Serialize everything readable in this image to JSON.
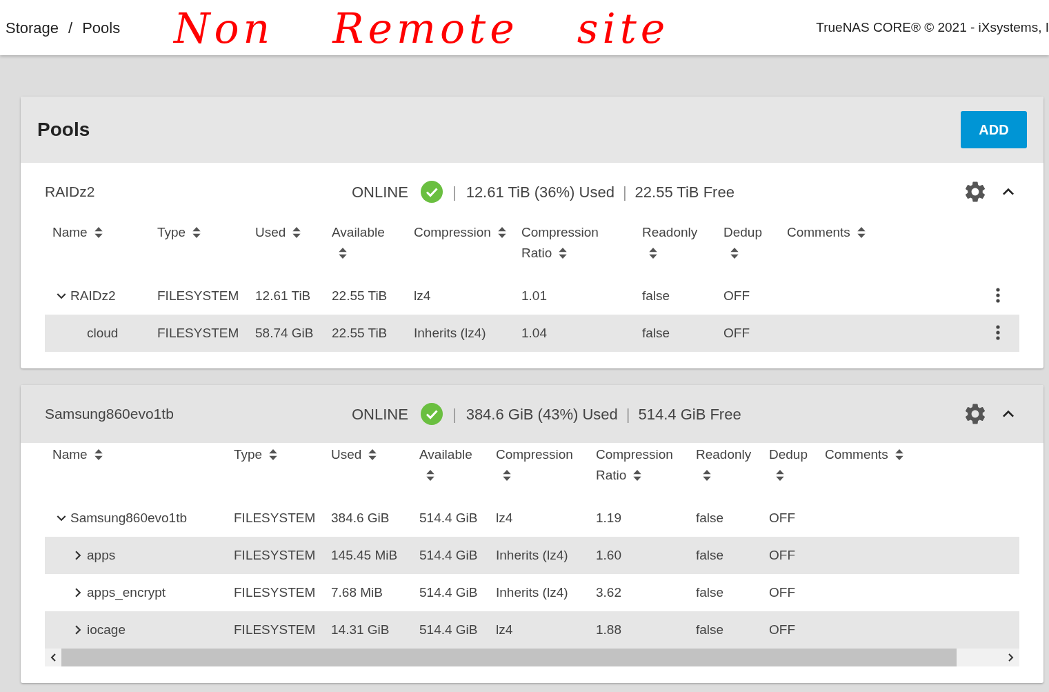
{
  "breadcrumb": [
    "Storage",
    "Pools"
  ],
  "annotation": "Non Remote site",
  "breadcrumb_separator": "/",
  "stat_separator": "|",
  "copyright": "TrueNAS CORE® © 2021 - iXsystems, I",
  "page_title": "Pools",
  "add_button": "ADD",
  "pools": [
    {
      "name": "RAIDz2",
      "highlighted": false,
      "status": "ONLINE",
      "healthy": true,
      "used": "12.61 TiB (36%) Used",
      "free": "22.55 TiB Free",
      "expanded": true,
      "columns": [
        {
          "label": "Name"
        },
        {
          "label": "Type"
        },
        {
          "label": "Used"
        },
        {
          "label": "Available"
        },
        {
          "label": "Compression"
        },
        {
          "label": "Compression Ratio"
        },
        {
          "label": "Readonly"
        },
        {
          "label": "Dedup"
        },
        {
          "label": "Comments"
        }
      ],
      "rows": [
        {
          "cells": [
            "RAIDz2",
            "FILESYSTEM",
            "12.61 TiB",
            "22.55 TiB",
            "lz4",
            "1.01",
            "false",
            "OFF"
          ],
          "expanded": true,
          "menu": true,
          "children": [
            {
              "cells": [
                "cloud",
                "FILESYSTEM",
                "58.74 GiB",
                "22.55 TiB",
                "Inherits (lz4)",
                "1.04",
                "false",
                "OFF"
              ],
              "menu": true
            }
          ]
        }
      ]
    },
    {
      "name": "Samsung860evo1tb",
      "highlighted": true,
      "status": "ONLINE",
      "healthy": true,
      "used": "384.6 GiB (43%) Used",
      "free": "514.4 GiB Free",
      "expanded": true,
      "has_scrollbar": true,
      "columns": [
        {
          "label": "Name"
        },
        {
          "label": "Type"
        },
        {
          "label": "Used"
        },
        {
          "label": "Available"
        },
        {
          "label": "Compression"
        },
        {
          "label": "Compression Ratio"
        },
        {
          "label": "Readonly"
        },
        {
          "label": "Dedup"
        },
        {
          "label": "Comments"
        }
      ],
      "rows": [
        {
          "cells": [
            "Samsung860evo1tb",
            "FILESYSTEM",
            "384.6 GiB",
            "514.4 GiB",
            "lz4",
            "1.19",
            "false",
            "OFF"
          ],
          "expanded": true,
          "children": [
            {
              "cells": [
                "apps",
                "FILESYSTEM",
                "145.45 MiB",
                "514.4 GiB",
                "Inherits (lz4)",
                "1.60",
                "false",
                "OFF"
              ],
              "expanded": false
            },
            {
              "cells": [
                "apps_encrypt",
                "FILESYSTEM",
                "7.68 MiB",
                "514.4 GiB",
                "Inherits (lz4)",
                "3.62",
                "false",
                "OFF"
              ],
              "expanded": false
            },
            {
              "cells": [
                "iocage",
                "FILESYSTEM",
                "14.31 GiB",
                "514.4 GiB",
                "lz4",
                "1.88",
                "false",
                "OFF"
              ],
              "expanded": false
            }
          ]
        }
      ]
    }
  ]
}
